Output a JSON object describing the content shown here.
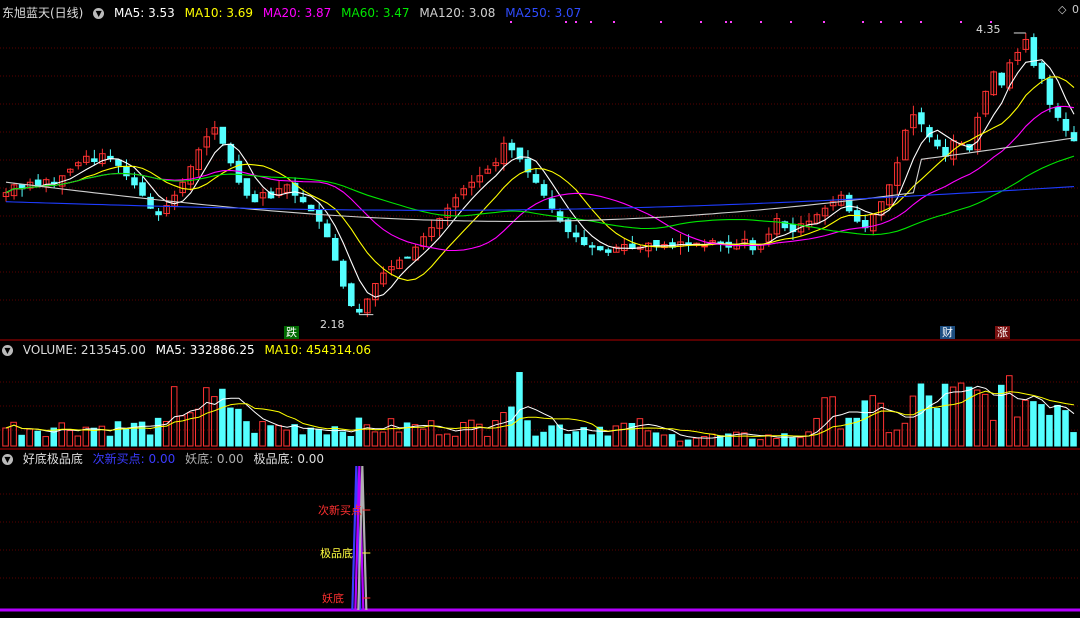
{
  "theme": {
    "up": "#ff3232",
    "down": "#54ffff",
    "ma5": "#ffffff",
    "ma10": "#ffff00",
    "ma20": "#ff00ff",
    "ma60": "#00e600",
    "ma120": "#d0d0d0",
    "ma250": "#1e3cff",
    "vol_ma5": "#ffffff",
    "vol_ma10": "#ffff00",
    "sig1": "#3b3bff",
    "sig2": "#b0b0b0",
    "sig3": "#b400ff",
    "grid": "#5a0000"
  },
  "main": {
    "title": "东旭蓝天(日线)",
    "ma5_label": "MA5: 3.53",
    "ma10_label": "MA10: 3.69",
    "ma20_label": "MA20: 3.87",
    "ma60_label": "MA60: 3.47",
    "ma120_label": "MA120: 3.08",
    "ma250_label": "MA250: 3.07",
    "high_label": "4.35",
    "low_label": "2.18",
    "tag_die": "跌",
    "tag_cai": "财",
    "tag_zhang": "涨",
    "corner_icon": "diamond-icon",
    "corner_text": "0"
  },
  "volume": {
    "label": "VOLUME: 213545.00",
    "ma5_label": "MA5: 332886.25",
    "ma10_label": "MA10: 454314.06"
  },
  "indicator": {
    "name": "好底极品底",
    "s1_label": "次新买点: 0.00",
    "s2_label": "妖底: 0.00",
    "s3_label": "极品底: 0.00",
    "ann1": "次新买点",
    "ann2": "极品底",
    "ann3": "妖底"
  },
  "chart_data": {
    "type": "candlestick",
    "price_range": [
      2.0,
      4.45
    ],
    "high": 4.35,
    "low": 2.18,
    "closes": [
      3.12,
      3.18,
      3.15,
      3.2,
      3.17,
      3.22,
      3.19,
      3.25,
      3.3,
      3.35,
      3.4,
      3.36,
      3.42,
      3.38,
      3.33,
      3.25,
      3.18,
      3.1,
      3.0,
      2.95,
      3.02,
      3.1,
      3.2,
      3.32,
      3.45,
      3.55,
      3.62,
      3.5,
      3.35,
      3.2,
      3.1,
      3.05,
      3.12,
      3.08,
      3.15,
      3.18,
      3.1,
      3.05,
      2.98,
      2.9,
      2.78,
      2.6,
      2.4,
      2.25,
      2.2,
      2.3,
      2.42,
      2.5,
      2.55,
      2.6,
      2.62,
      2.7,
      2.78,
      2.85,
      2.92,
      3.0,
      3.08,
      3.15,
      3.2,
      3.25,
      3.3,
      3.35,
      3.5,
      3.45,
      3.38,
      3.28,
      3.2,
      3.1,
      3.0,
      2.9,
      2.82,
      2.78,
      2.72,
      2.7,
      2.68,
      2.66,
      2.7,
      2.72,
      2.69,
      2.7,
      2.73,
      2.71,
      2.72,
      2.7,
      2.74,
      2.72,
      2.73,
      2.71,
      2.75,
      2.73,
      2.7,
      2.72,
      2.76,
      2.68,
      2.72,
      2.8,
      2.92,
      2.85,
      2.82,
      2.88,
      2.9,
      2.95,
      3.0,
      3.05,
      3.1,
      2.98,
      2.9,
      2.85,
      2.95,
      3.05,
      3.18,
      3.35,
      3.6,
      3.72,
      3.65,
      3.55,
      3.48,
      3.4,
      3.52,
      3.5,
      3.45,
      3.7,
      3.9,
      4.05,
      3.95,
      4.12,
      4.2,
      4.3,
      4.1,
      4.0,
      3.8,
      3.7,
      3.6,
      3.52
    ],
    "volume_range": [
      0,
      1400000
    ],
    "volume_last": 213545.0,
    "indicator_series": [
      {
        "name": "次新买点",
        "value": 0.0
      },
      {
        "name": "妖底",
        "value": 0.0
      },
      {
        "name": "极品底",
        "value": 0.0
      }
    ]
  }
}
